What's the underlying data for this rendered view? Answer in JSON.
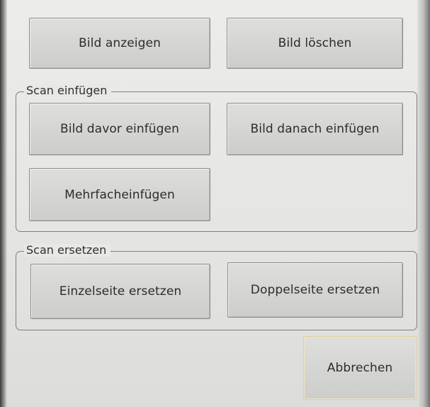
{
  "dialog": {
    "top_buttons": {
      "show_image": "Bild anzeigen",
      "delete_image": "Bild löschen"
    },
    "insert_group": {
      "title": "Scan einfügen",
      "insert_before": "Bild davor einfügen",
      "insert_after": "Bild danach einfügen",
      "multi_insert": "Mehrfacheinfügen"
    },
    "replace_group": {
      "title": "Scan ersetzen",
      "replace_single": "Einzelseite ersetzen",
      "replace_double": "Doppelseite ersetzen"
    },
    "cancel": "Abbrechen"
  }
}
